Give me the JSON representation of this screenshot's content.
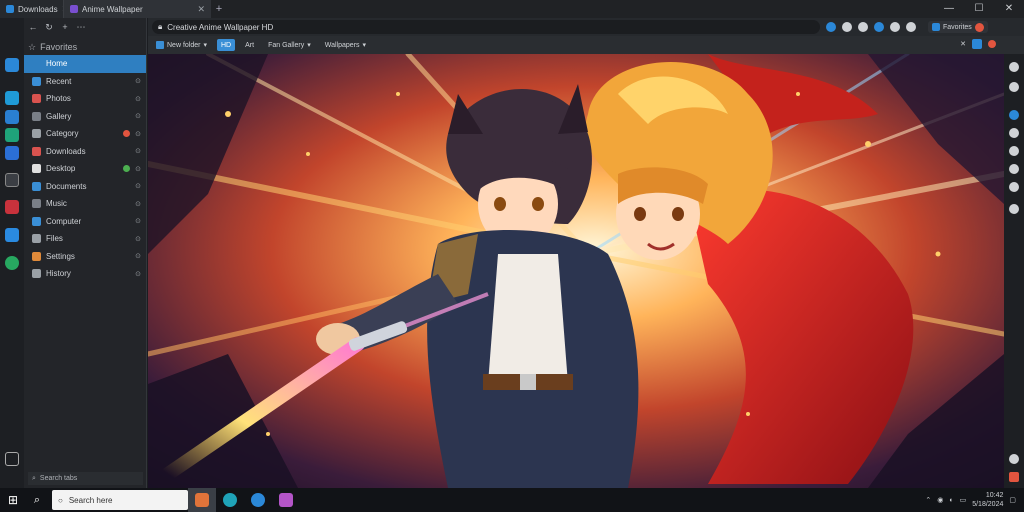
{
  "titlebar": {
    "tabs": [
      {
        "label": "Downloads"
      },
      {
        "label": "Anime Wallpaper"
      }
    ],
    "new_tab": "+",
    "controls": {
      "minimize": "—",
      "maximize": "☐",
      "close": "✕"
    }
  },
  "sidebar": {
    "toolbar": {
      "back": "←",
      "refresh": "↻",
      "add": "+",
      "menu": "⋯"
    },
    "search": {
      "label": "Favorites"
    },
    "items": [
      {
        "label": "Home",
        "tail": "",
        "color": "#2f7fc1"
      },
      {
        "label": "Recent",
        "tail": "⊙",
        "color": "#3a8fd6"
      },
      {
        "label": "Photos",
        "tail": "⊙",
        "color": "#d9534f"
      },
      {
        "label": "Gallery",
        "tail": "⊙",
        "color": "#7a7f87"
      },
      {
        "label": "Category",
        "tail": "⊙",
        "color": "#9aa0a6",
        "badge": "#e2553f"
      },
      {
        "label": "Downloads",
        "tail": "⊙",
        "color": "#d9534f"
      },
      {
        "label": "Desktop",
        "tail": "⊙",
        "color": "#e0e0e0",
        "badge": "#4caf50"
      },
      {
        "label": "Documents",
        "tail": "⊙",
        "color": "#3a8fd6"
      },
      {
        "label": "Music",
        "tail": "⊙",
        "color": "#7a7f87"
      },
      {
        "label": "Computer",
        "tail": "⊙",
        "color": "#3a8fd6"
      },
      {
        "label": "Files",
        "tail": "⊙",
        "color": "#9aa0a6"
      },
      {
        "label": "Settings",
        "tail": "⊙",
        "color": "#e08a3a"
      },
      {
        "label": "History",
        "tail": "⊙",
        "color": "#9aa0a6"
      }
    ],
    "footer": "Search tabs"
  },
  "addressbar": {
    "url": "Creative Anime Wallpaper HD"
  },
  "bookmarks": {
    "items": [
      {
        "label": "New folder"
      },
      {
        "label": "HD",
        "tail": "Art"
      },
      {
        "label": "Fan Gallery"
      },
      {
        "label": "Wallpapers"
      }
    ],
    "right_label": "Favorites"
  },
  "taskbar": {
    "search_placeholder": "Search here",
    "clock_time": "10:42",
    "clock_date": "5/18/2024"
  }
}
